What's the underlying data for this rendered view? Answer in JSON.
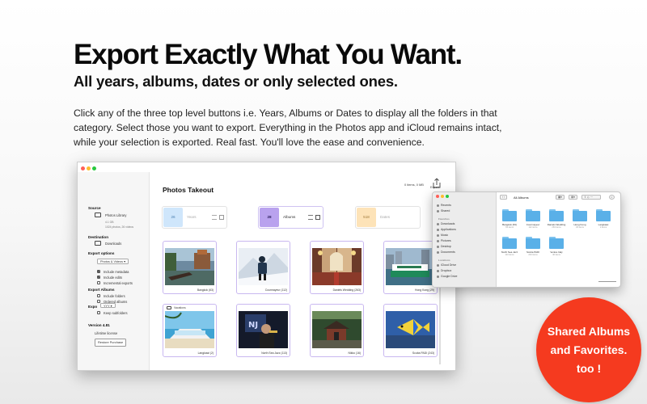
{
  "headline": "Export Exactly What You Want.",
  "subheadline": "All years, albums, dates or only selected ones.",
  "description": "Click any of the three top level buttons i.e. Years, Albums or Dates to display all the folders in that category. Select those you want to export. Everything in the Photos app and iCloud remains intact, while your selection is exported. Real fast. You'll love the ease and convenience.",
  "app": {
    "title": "Photos Takeout",
    "counter": "0 items, 0 MB",
    "export_label": "Export",
    "sidebar": {
      "source_heading": "Source",
      "source_name": "Photos Library",
      "source_size": "4.1 GB",
      "source_count": "1024 photos, 26 videos",
      "destination_heading": "Destination",
      "destination_name": "Downloads",
      "export_options_heading": "Export options",
      "media_select": "Photos & Videos",
      "include_metadata": "Include metadata",
      "include_edits": "Include edits",
      "incremental_exports": "Incremental exports",
      "export_albums_heading": "Export Albums",
      "include_folders": "Include folders",
      "ordered_albums": "Ordered albums",
      "export_years_heading": "Expo",
      "export_years_select": "YYY",
      "keep_subfolders": "Keep subfolders",
      "version": "Version 4.81",
      "license": "Lifetime license",
      "restore_button": "Restore Purchase"
    },
    "categories": [
      {
        "count": "26",
        "label": "Years"
      },
      {
        "count": "28",
        "label": "Albums"
      },
      {
        "count": "518",
        "label": "Dates"
      }
    ],
    "albums": [
      {
        "caption": "Bangkok (63)"
      },
      {
        "caption": "Courmayeur (112)"
      },
      {
        "caption": "Daniels Wedding (263)"
      },
      {
        "caption": "Hong Kong (29)"
      },
      {
        "caption": "Langkawi (2)",
        "folder": "Vacations"
      },
      {
        "caption": "North Sea Jazz (113)"
      },
      {
        "caption": "Nikko (16)"
      },
      {
        "caption": "Scuba PADI (243)"
      }
    ]
  },
  "finder": {
    "title": "All Albums",
    "sidebar_items": [
      "Recents",
      "Shared"
    ],
    "favorites_heading": "Favorites",
    "favorites": [
      "Downloads",
      "Applications",
      "Music",
      "Pictures",
      "Desktop",
      "Documents"
    ],
    "locations_heading": "Locations",
    "locations": [
      "iCloud Drive",
      "Dropbox",
      "Google Drive"
    ],
    "folders": [
      {
        "name": "Bangkok (63)",
        "info": "63 items"
      },
      {
        "name": "Courmayeur",
        "info": "112 items"
      },
      {
        "name": "Daniels Wedding",
        "info": "263 items"
      },
      {
        "name": "Hong Kong",
        "info": "29 items"
      },
      {
        "name": "Langkawi",
        "info": "2 items"
      },
      {
        "name": "North Sea Jazz",
        "info": "113 items"
      },
      {
        "name": "Scuba PADI",
        "info": "243 items"
      },
      {
        "name": "Venice Italy",
        "info": "40 items"
      }
    ]
  },
  "badge": {
    "line1": "Shared Albums",
    "line2": "and Favorites.",
    "line3": "too !"
  },
  "colors": {
    "years_accent": "#cfe6fb",
    "albums_accent": "#b9a2ee",
    "dates_accent": "#fde3b8",
    "badge": "#f53a1f",
    "folder": "#5ab0e8"
  }
}
